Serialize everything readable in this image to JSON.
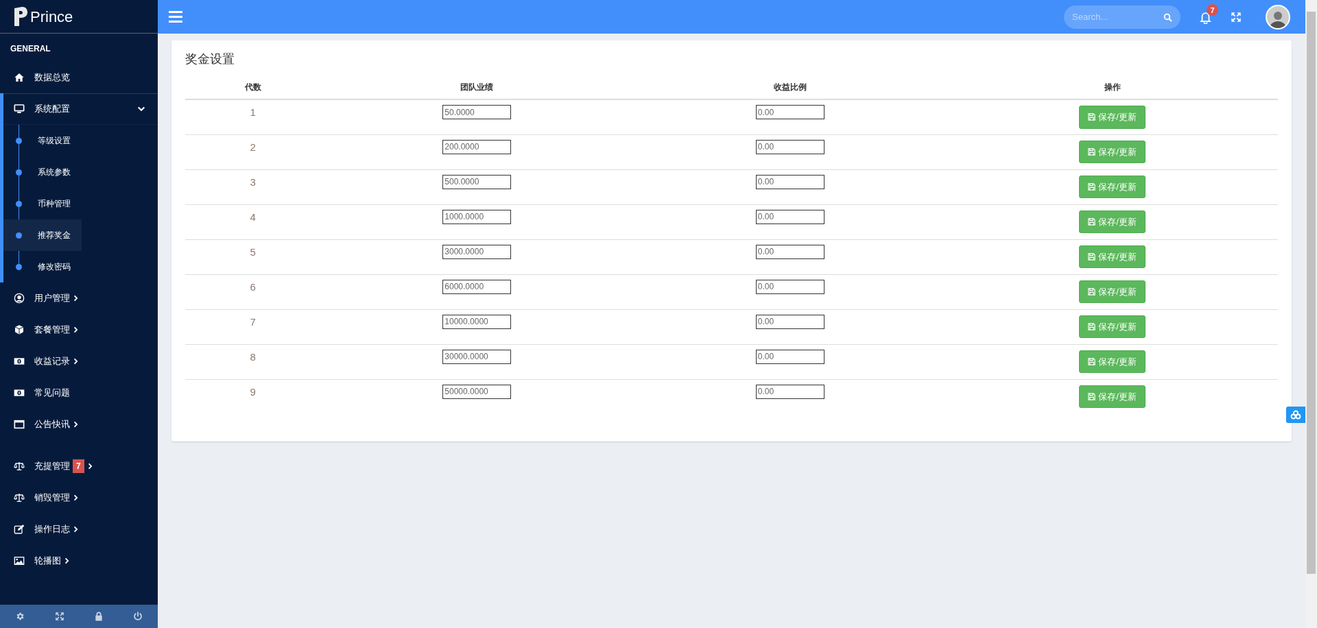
{
  "brand": {
    "name": "Prince"
  },
  "sidebar": {
    "sections": [
      {
        "title": "GENERAL",
        "items": [
          {
            "label": "数据总览",
            "submenu": false
          },
          {
            "label": "系统配置",
            "submenu": true,
            "expanded": true,
            "children": [
              {
                "label": "等级设置",
                "selected": false
              },
              {
                "label": "系统参数",
                "selected": false
              },
              {
                "label": "币种管理",
                "selected": false
              },
              {
                "label": "推荐奖金",
                "selected": true
              },
              {
                "label": "修改密码",
                "selected": false
              }
            ]
          },
          {
            "label": "用户管理",
            "submenu": true
          },
          {
            "label": "套餐管理",
            "submenu": true
          },
          {
            "label": "收益记录",
            "submenu": true
          },
          {
            "label": "常见问题",
            "submenu": false
          },
          {
            "label": "公告快讯",
            "submenu": true
          }
        ]
      },
      {
        "items": [
          {
            "label": "充提管理",
            "submenu": true,
            "badge": "7"
          },
          {
            "label": "销毁管理",
            "submenu": true
          },
          {
            "label": "操作日志",
            "submenu": true
          },
          {
            "label": "轮播图",
            "submenu": true
          }
        ]
      }
    ]
  },
  "topbar": {
    "search": {
      "placeholder": "Search..."
    },
    "notifications": {
      "count": "7"
    }
  },
  "card": {
    "title": "奖金设置",
    "table": {
      "columns": [
        "代数",
        "团队业绩",
        "收益比例",
        "操作"
      ],
      "rows": [
        {
          "generation": "1",
          "team_performance": "50.0000",
          "ratio": "0.00",
          "action": "保存/更新"
        },
        {
          "generation": "2",
          "team_performance": "200.0000",
          "ratio": "0.00",
          "action": "保存/更新"
        },
        {
          "generation": "3",
          "team_performance": "500.0000",
          "ratio": "0.00",
          "action": "保存/更新"
        },
        {
          "generation": "4",
          "team_performance": "1000.0000",
          "ratio": "0.00",
          "action": "保存/更新"
        },
        {
          "generation": "5",
          "team_performance": "3000.0000",
          "ratio": "0.00",
          "action": "保存/更新"
        },
        {
          "generation": "6",
          "team_performance": "6000.0000",
          "ratio": "0.00",
          "action": "保存/更新"
        },
        {
          "generation": "7",
          "team_performance": "10000.0000",
          "ratio": "0.00",
          "action": "保存/更新"
        },
        {
          "generation": "8",
          "team_performance": "30000.0000",
          "ratio": "0.00",
          "action": "保存/更新"
        },
        {
          "generation": "9",
          "team_performance": "50000.0000",
          "ratio": "0.00",
          "action": "保存/更新"
        }
      ]
    }
  }
}
